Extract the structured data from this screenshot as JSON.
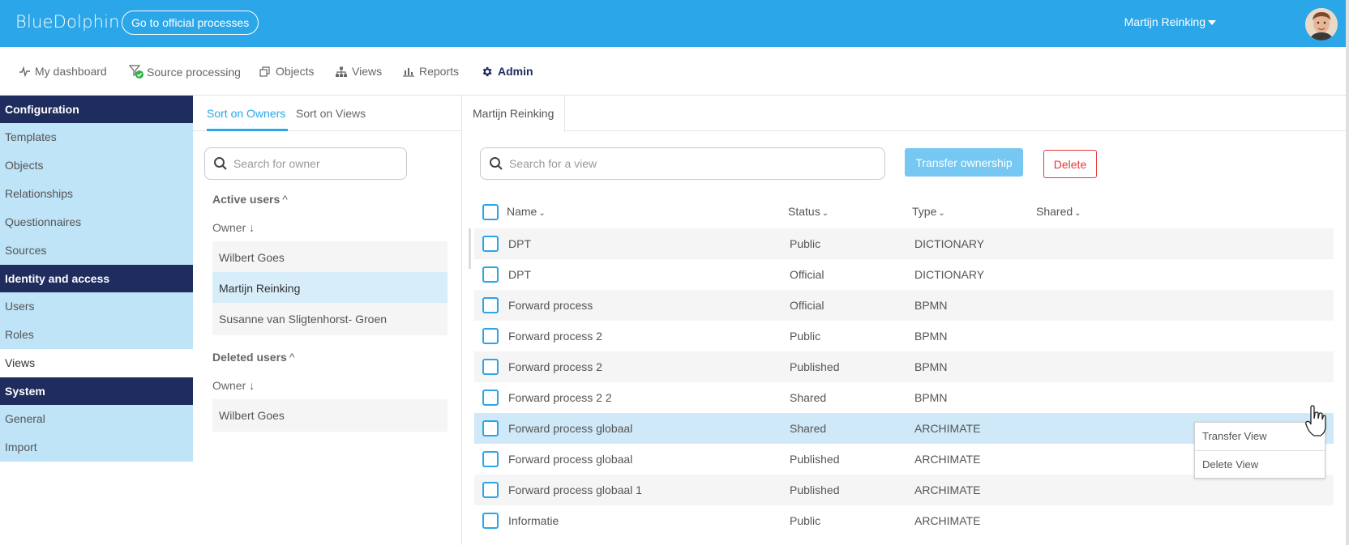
{
  "app": {
    "brand": "BlueDolphin",
    "official_processes_button": "Go to official processes",
    "user_name": "Martijn Reinking"
  },
  "nav": {
    "items": [
      {
        "label": "My dashboard",
        "icon": "pulse-icon"
      },
      {
        "label": "Source processing",
        "icon": "filter-check-icon"
      },
      {
        "label": "Objects",
        "icon": "objects-icon"
      },
      {
        "label": "Views",
        "icon": "hierarchy-icon"
      },
      {
        "label": "Reports",
        "icon": "bar-chart-icon"
      },
      {
        "label": "Admin",
        "icon": "gear-icon",
        "active": true
      }
    ]
  },
  "sidebar": {
    "sections": [
      {
        "title": "Configuration",
        "items": [
          "Templates",
          "Objects",
          "Relationships",
          "Questionnaires",
          "Sources"
        ]
      },
      {
        "title": "Identity and access",
        "items": [
          "Users",
          "Roles",
          "Views"
        ]
      },
      {
        "title": "System",
        "items": [
          "General",
          "Import"
        ]
      }
    ],
    "current": "Views"
  },
  "owners_panel": {
    "tabs": [
      "Sort on Owners",
      "Sort on Views"
    ],
    "active_tab": "Sort on Owners",
    "search_placeholder": "Search for owner",
    "active_users": {
      "title": "Active users",
      "owner_label": "Owner",
      "owners": [
        "Wilbert Goes",
        "Martijn Reinking",
        "Susanne van Sligtenhorst- Groen"
      ],
      "selected": "Martijn Reinking"
    },
    "deleted_users": {
      "title": "Deleted users",
      "owner_label": "Owner",
      "owners": [
        "Wilbert Goes"
      ]
    }
  },
  "main": {
    "tab": "Martijn Reinking",
    "search_placeholder": "Search for a view",
    "transfer_button": "Transfer ownership",
    "delete_button": "Delete",
    "columns": {
      "name": "Name",
      "status": "Status",
      "type": "Type",
      "shared": "Shared"
    },
    "rows": [
      {
        "name": "DPT",
        "status": "Public",
        "type": "DICTIONARY"
      },
      {
        "name": "DPT",
        "status": "Official",
        "type": "DICTIONARY"
      },
      {
        "name": "Forward process",
        "status": "Official",
        "type": "BPMN"
      },
      {
        "name": "Forward process 2",
        "status": "Public",
        "type": "BPMN"
      },
      {
        "name": "Forward process 2",
        "status": "Published",
        "type": "BPMN"
      },
      {
        "name": "Forward process 2 2",
        "status": "Shared",
        "type": "BPMN"
      },
      {
        "name": "Forward process globaal",
        "status": "Shared",
        "type": "ARCHIMATE",
        "highlighted": true
      },
      {
        "name": "Forward process globaal",
        "status": "Published",
        "type": "ARCHIMATE"
      },
      {
        "name": "Forward process globaal 1",
        "status": "Published",
        "type": "ARCHIMATE"
      },
      {
        "name": "Informatie",
        "status": "Public",
        "type": "ARCHIMATE"
      }
    ],
    "more_label": "···",
    "context_menu": [
      "Transfer View",
      "Delete View"
    ]
  }
}
